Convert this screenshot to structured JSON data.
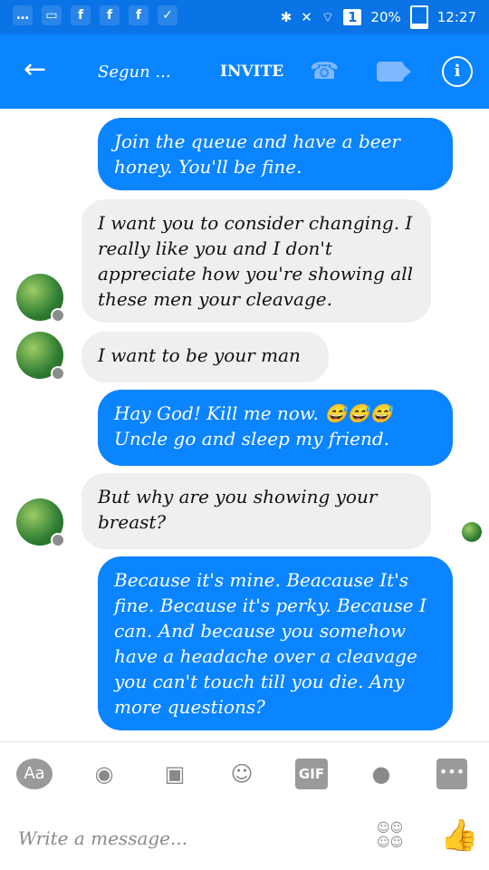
{
  "status_bar": {
    "battery": "20%",
    "time": "12:27",
    "sim_number": "1"
  },
  "header": {
    "back": "←",
    "title": "Segun ...",
    "invite": "INVITE",
    "call_icon": "☎",
    "info_label": "i"
  },
  "messages": [
    {
      "side": "out",
      "text": "Join the queue and have a beer honey. You'll be fine."
    },
    {
      "side": "in",
      "text": "I want you to consider changing. I really like you and I don't appreciate how you're showing all these men your cleavage."
    },
    {
      "side": "in",
      "text": "I want to be your man"
    },
    {
      "side": "out",
      "text": "Hay God! Kill me now. 😅😅😅 Uncle go and sleep my friend."
    },
    {
      "side": "in",
      "text": "But why are you showing your breast?"
    },
    {
      "side": "out",
      "text": "Because it's mine. Beacause It's fine. Because it's perky. Because I can. And because you somehow have a headache over a cleavage you can't touch till you die. Any more questions?"
    }
  ],
  "toolbar": {
    "aa": "Aa",
    "camera": "◉",
    "image": "▣",
    "emoji": "☺",
    "gif": "GIF",
    "mic": "●",
    "more": "•••"
  },
  "composer": {
    "placeholder": "Write a message...",
    "stickers": "☺☺☺☺",
    "like": "👍"
  },
  "colors": {
    "header": "#0a84ff",
    "bubble_out": "#0a84ff",
    "bubble_in": "#efefef"
  }
}
